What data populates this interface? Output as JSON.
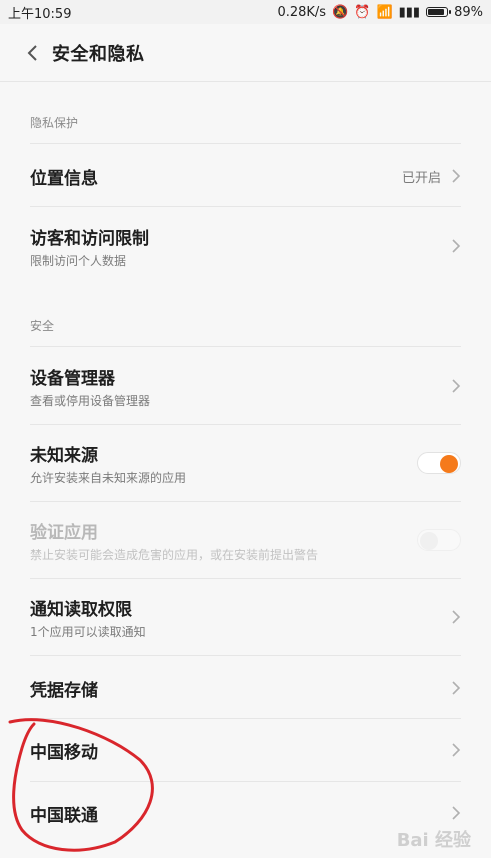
{
  "status_bar": {
    "time": "上午10:59",
    "network_speed": "0.28K/s",
    "battery": "89%",
    "battery_level": 0.89
  },
  "header": {
    "title": "安全和隐私",
    "back_icon": "chevron-left-icon"
  },
  "sections": [
    {
      "label": "隐私保护"
    },
    {
      "label": "安全"
    }
  ],
  "items": {
    "location": {
      "title": "位置信息",
      "value": "已开启"
    },
    "visitor": {
      "title": "访客和访问限制",
      "subtitle": "限制访问个人数据"
    },
    "device_admin": {
      "title": "设备管理器",
      "subtitle": "查看或停用设备管理器"
    },
    "unknown_sources": {
      "title": "未知来源",
      "subtitle": "允许安装来自未知来源的应用",
      "enabled": true
    },
    "verify_apps": {
      "title": "验证应用",
      "subtitle": "禁止安装可能会造成危害的应用，或在安装前提出警告",
      "enabled": false
    },
    "notification_access": {
      "title": "通知读取权限",
      "subtitle": "1个应用可以读取通知"
    },
    "credential_storage": {
      "title": "凭据存储"
    },
    "china_mobile": {
      "title": "中国移动"
    },
    "china_unicom": {
      "title": "中国联通"
    }
  },
  "colors": {
    "accent": "#f57a1b",
    "annotation": "#d9262c"
  },
  "watermark": "Bai 经验"
}
